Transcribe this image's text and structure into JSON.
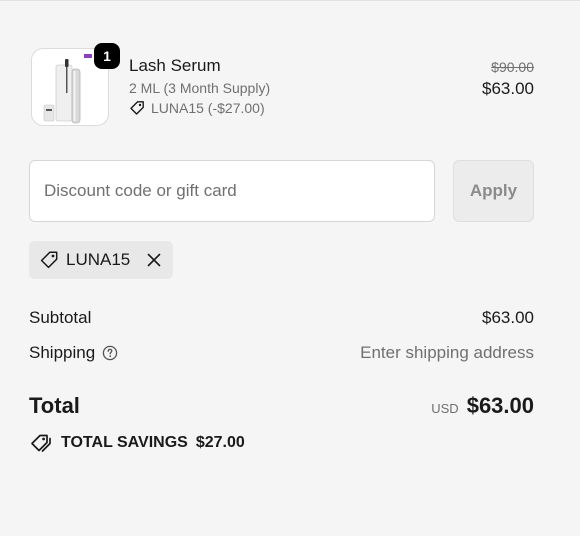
{
  "cart": {
    "item": {
      "name": "Lash Serum",
      "variant": "2 ML (3 Month Supply)",
      "discount_line": "LUNA15 (-$27.00)",
      "original_price": "$90.00",
      "final_price": "$63.00",
      "quantity": "1",
      "image_icon": "serum-bottle-image"
    }
  },
  "discount": {
    "placeholder": "Discount code or gift card",
    "apply_label": "Apply",
    "applied_code": "LUNA15"
  },
  "summary": {
    "subtotal_label": "Subtotal",
    "subtotal_value": "$63.00",
    "shipping_label": "Shipping",
    "shipping_value": "Enter shipping address",
    "total_label": "Total",
    "currency": "USD",
    "total_value": "$63.00",
    "savings_label": "TOTAL SAVINGS",
    "savings_value": "$27.00"
  },
  "colors": {
    "background": "#f5f5f5",
    "badge": "#000000",
    "muted_text": "#707070"
  }
}
